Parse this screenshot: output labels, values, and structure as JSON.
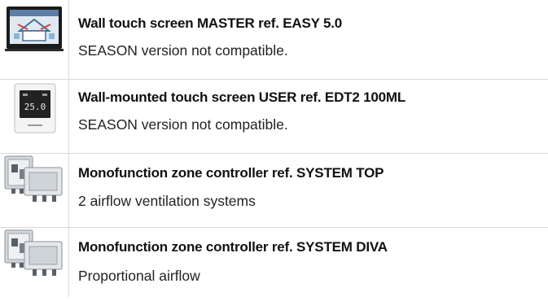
{
  "rows": [
    {
      "title": "Wall touch screen MASTER ref. EASY 5.0",
      "subtitle": "SEASON version not compatible.",
      "image": "wall-touch-screen-master-image"
    },
    {
      "title": "Wall-mounted touch screen USER ref. EDT2 100ML",
      "subtitle": "SEASON version not compatible.",
      "image": "wall-mounted-touch-screen-user-image",
      "display_value": "25.0"
    },
    {
      "title": "Monofunction zone controller ref. SYSTEM TOP",
      "subtitle": "2 airflow ventilation systems",
      "image": "zone-controller-image"
    },
    {
      "title": "Monofunction zone controller ref. SYSTEM DIVA",
      "subtitle": "Proportional airflow",
      "image": "zone-controller-image"
    }
  ],
  "colors": {
    "border": "#d9d9d9",
    "text": "#1a1a1a"
  }
}
